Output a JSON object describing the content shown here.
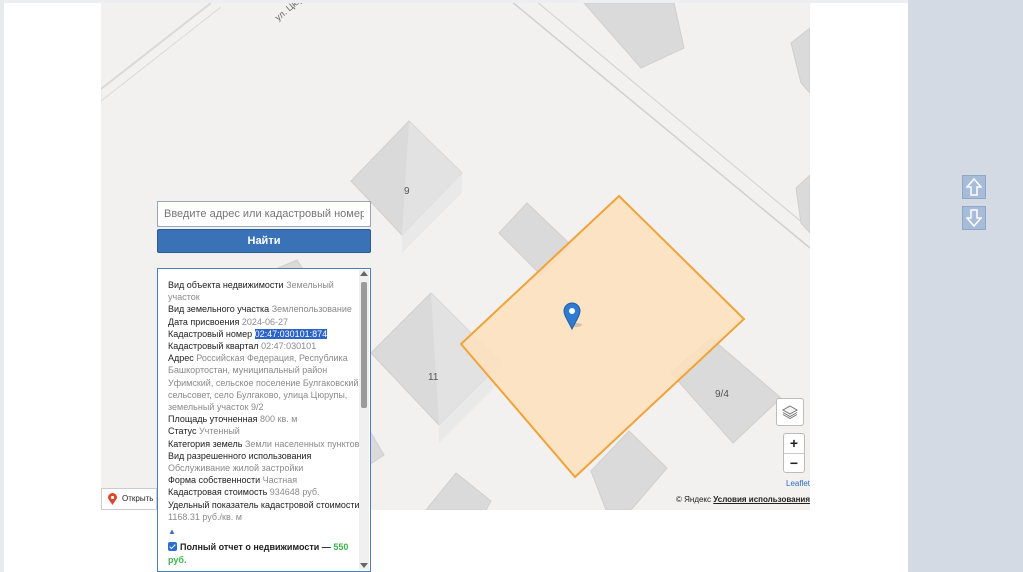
{
  "map": {
    "street_label": "ул. Цюру…",
    "house_labels": [
      "9",
      "11",
      "9/4"
    ],
    "parcel_fill": "#fde1bb",
    "parcel_stroke": "#f0a33a",
    "marker_color": "#2f7bd1"
  },
  "search": {
    "placeholder": "Введите адрес или кадастровый номер: Республи",
    "button_label": "Найти"
  },
  "info": {
    "rows": [
      {
        "label": "Вид объекта недвижимости",
        "value": "Земельный участок"
      },
      {
        "label": "Вид земельного участка",
        "value": "Землепользование"
      },
      {
        "label": "Дата присвоения",
        "value": "2024-06-27"
      },
      {
        "label": "Кадастровый номер",
        "value": "02:47:030101:874"
      },
      {
        "label": "Кадастровый квартал",
        "value": "02:47:030101"
      },
      {
        "label": "Адрес",
        "value": "Российская Федерация, Республика Башкортостан, муниципальный район Уфимский, сельское поселение Булгаковский сельсовет, село Булгаково, улица Цюрупы, земельный участок 9/2"
      },
      {
        "label": "Площадь уточненная",
        "value": "800 кв. м"
      },
      {
        "label": "Статус",
        "value": "Учтенный"
      },
      {
        "label": "Категория земель",
        "value": "Земли населенных пунктов"
      },
      {
        "label": "Вид разрешенного использования",
        "value": "Обслуживание жилой застройки"
      },
      {
        "label": "Форма собственности",
        "value": "Частная"
      },
      {
        "label": "Кадастровая стоимость",
        "value": "934648 руб."
      },
      {
        "label": "Удельный показатель кадастровой стоимости",
        "value": "1168.31 руб./кв. м"
      }
    ],
    "collapse_mark": "▲",
    "report_label": "Полный отчет о недвижимости —",
    "report_price": "550 руб."
  },
  "controls": {
    "zoom_in": "+",
    "zoom_out": "−",
    "leaflet": "Leaflet",
    "attribution_prefix": "© Яндекс",
    "attribution_terms": "Условия использования",
    "open_in": "Открыть в"
  },
  "colors": {
    "accent": "#3a72b8",
    "scroll_buttons": "#a6bcd8"
  }
}
